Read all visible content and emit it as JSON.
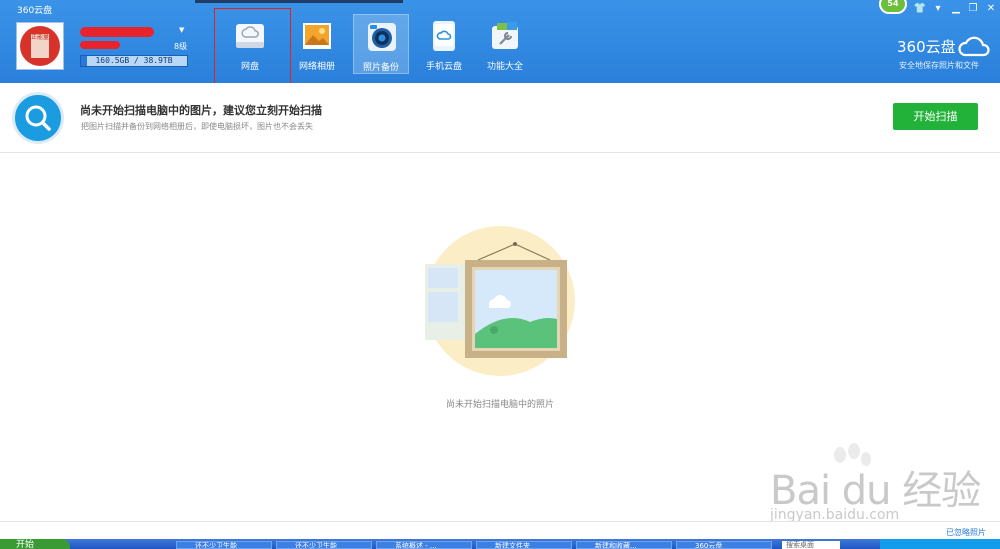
{
  "header": {
    "app_title": "360云盘",
    "level": "8级",
    "storage": {
      "used": "160.5GB",
      "total": "38.9TB",
      "display": "160.5GB / 38.9TB"
    },
    "badge": "54",
    "window_controls": [
      "shirt-icon",
      "caret-icon",
      "minimize-icon",
      "restore-icon",
      "close-icon"
    ],
    "nav": [
      {
        "label": "网盘",
        "icon": "cloud-disk-icon"
      },
      {
        "label": "网络相册",
        "icon": "photo-album-icon"
      },
      {
        "label": "照片备份",
        "icon": "camera-icon",
        "active": true
      },
      {
        "label": "手机云盘",
        "icon": "phone-cloud-icon"
      },
      {
        "label": "功能大全",
        "icon": "toolbox-icon"
      }
    ],
    "brand": {
      "name": "360云盘",
      "tagline": "安全地保存照片和文件"
    }
  },
  "info_bar": {
    "title": "尚未开始扫描电脑中的图片，建议您立刻开始扫描",
    "subtitle": "把图片扫描并备份到网络相册后，即使电脑损坏，图片也不会丢失",
    "button": "开始扫描"
  },
  "main": {
    "empty_text": "尚未开始扫描电脑中的照片"
  },
  "footer": {
    "ignored_link": "已忽略照片"
  },
  "watermark": {
    "text": "Bai du 经验",
    "url": "jingyan.baidu.com"
  },
  "taskbar": {
    "start": "开始",
    "tasks": [
      "还不少卫生能",
      "还不少卫生能",
      "系统概述 - ...",
      "新建文件夹",
      "新建和收藏...",
      "360云盘"
    ],
    "search_placeholder": "搜索桌面"
  },
  "colors": {
    "header_blue": "#2f87e0",
    "start_button_green": "#22b23a",
    "highlight_red": "#e0241f"
  }
}
